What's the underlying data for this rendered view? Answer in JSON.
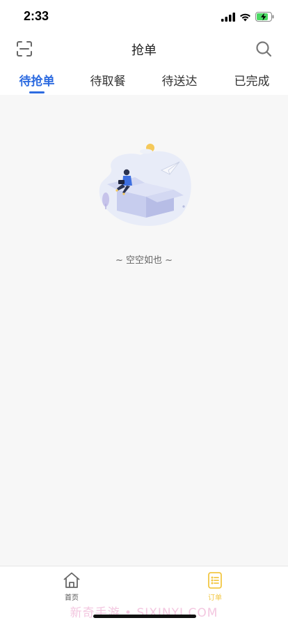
{
  "status_bar": {
    "time": "2:33"
  },
  "header": {
    "title": "抢单",
    "scan_icon": "scan-icon",
    "search_icon": "search-icon"
  },
  "tabs": [
    {
      "label": "待抢单",
      "active": true
    },
    {
      "label": "待取餐",
      "active": false
    },
    {
      "label": "待送达",
      "active": false
    },
    {
      "label": "已完成",
      "active": false
    }
  ],
  "empty_state": {
    "message": "~ 空空如也 ~"
  },
  "bottom_nav": {
    "items": [
      {
        "label": "首页",
        "icon": "home-icon",
        "active": false
      },
      {
        "label": "订单",
        "icon": "order-list-icon",
        "active": true
      }
    ]
  },
  "watermark": "新奇手游 • SIXINYI.COM",
  "colors": {
    "accent": "#2d6be0",
    "active_tab_bar": "#f2c744",
    "background": "#f7f7f7"
  }
}
